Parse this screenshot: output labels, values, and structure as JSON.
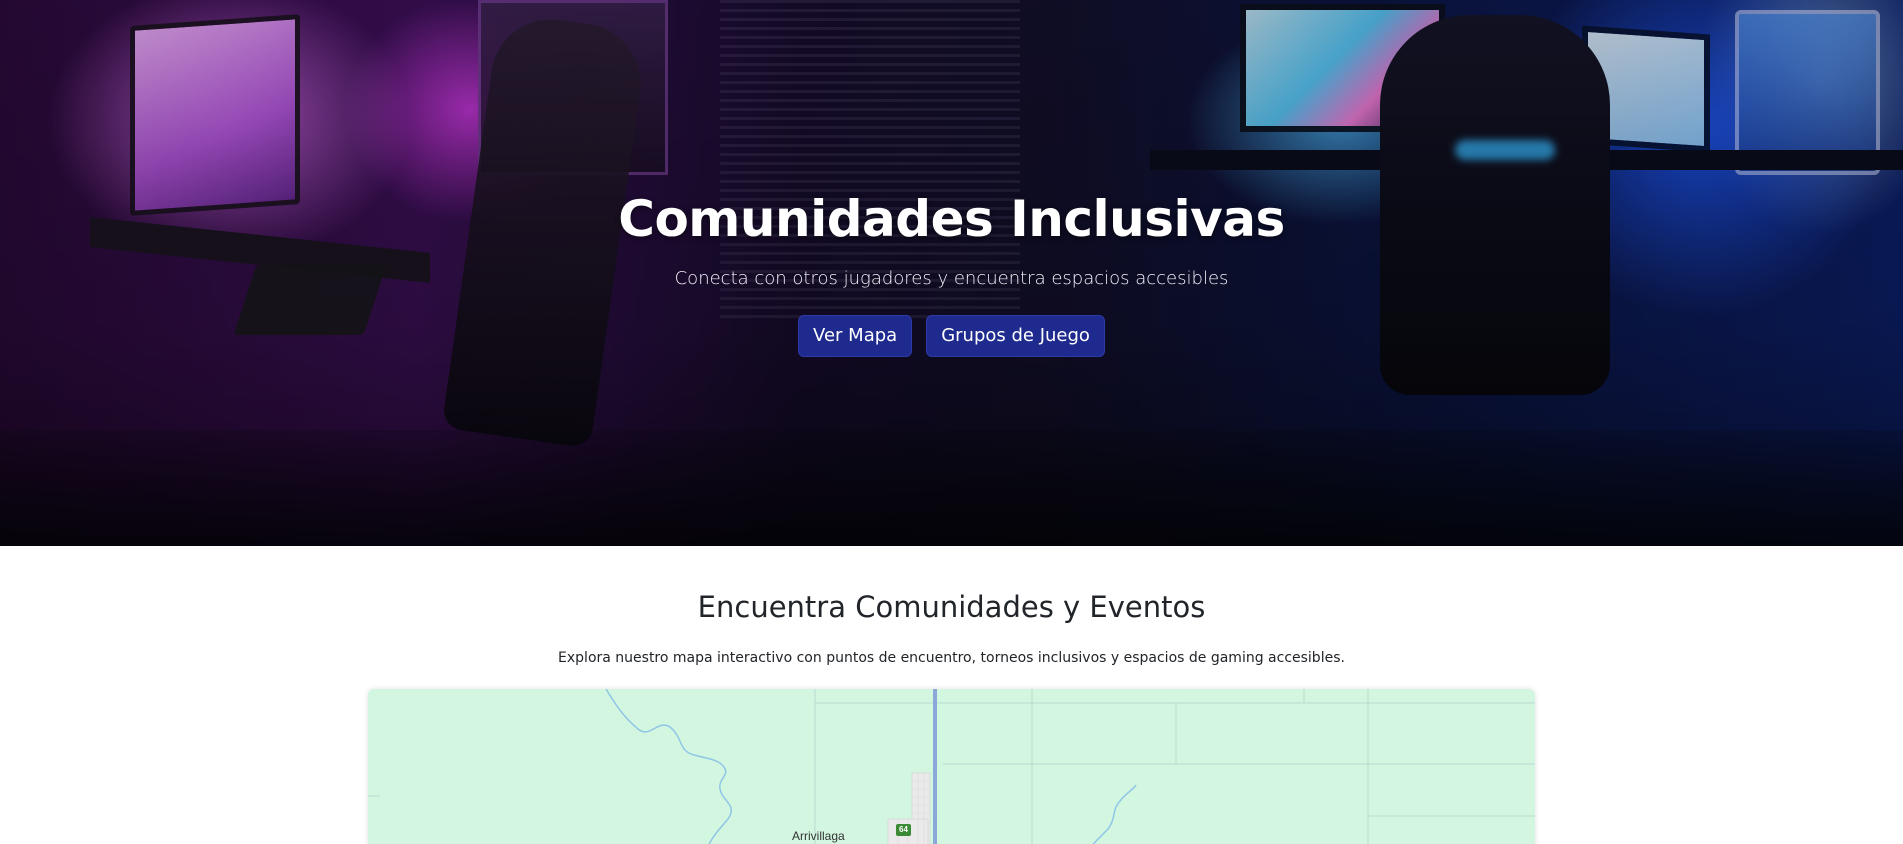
{
  "hero": {
    "title": "Comunidades Inclusivas",
    "subtitle": "Conecta con otros jugadores y encuentra espacios accesibles",
    "buttons": [
      "Ver Mapa",
      "Grupos de Juego"
    ]
  },
  "communities": {
    "title": "Encuentra Comunidades y Eventos",
    "description": "Explora nuestro mapa interactivo con puntos de encuentro, torneos inclusivos y espacios de gaming accesibles."
  },
  "map": {
    "place_label": "Arrivillaga",
    "route_number": "64"
  },
  "colors": {
    "button_bg": "#1f2a8f",
    "map_land": "#d3f6e0",
    "map_road": "#8aa8d8"
  }
}
